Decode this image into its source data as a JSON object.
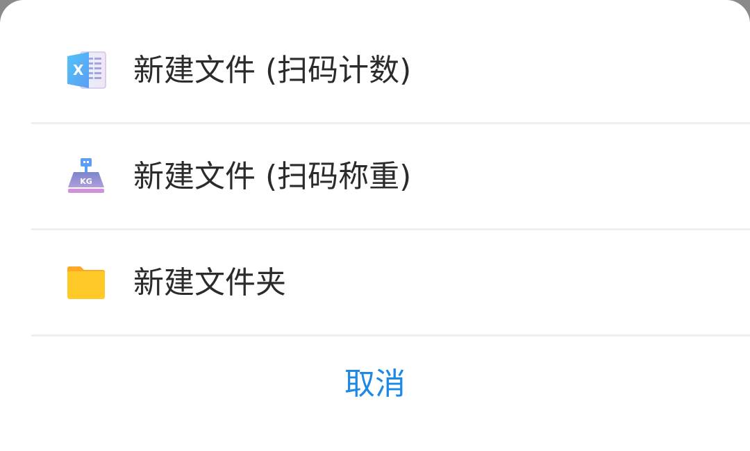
{
  "sheet": {
    "items": [
      {
        "label": "新建文件 (扫码计数)",
        "icon": "excel-file-icon"
      },
      {
        "label": "新建文件 (扫码称重)",
        "icon": "scale-kg-icon"
      },
      {
        "label": "新建文件夹",
        "icon": "folder-icon"
      }
    ],
    "cancel_label": "取消",
    "scale_icon_text": "KG",
    "excel_icon_letter": "X"
  },
  "colors": {
    "label_text": "#2b2b2b",
    "cancel_text": "#1e88e5",
    "divider": "#eeeeee",
    "folder_yellow": "#ffca28",
    "scale_purple": "#b39ddb",
    "excel_blue": "#42a5f5"
  }
}
